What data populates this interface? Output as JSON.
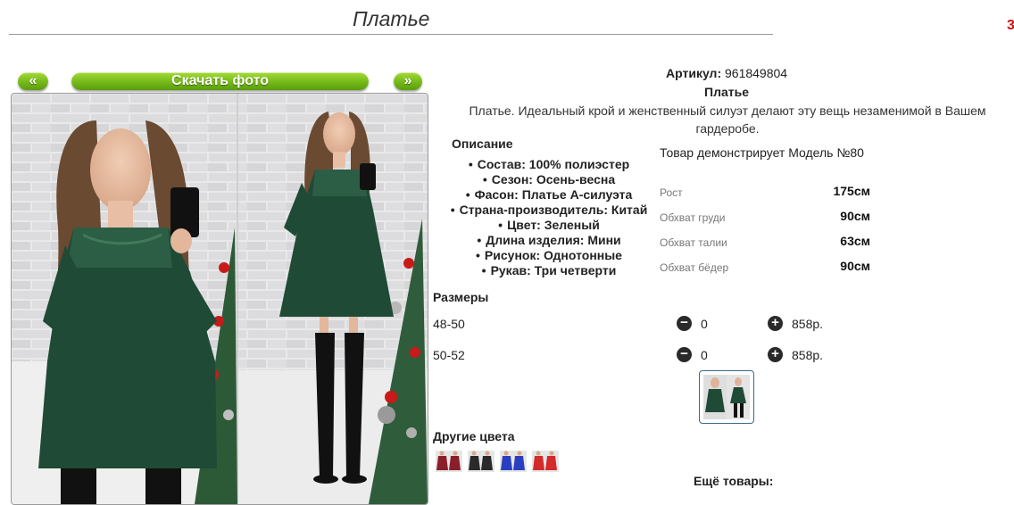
{
  "header": {
    "title": "Платье"
  },
  "gallery": {
    "prev_label": "«",
    "download_label": "Скачать фото",
    "next_label": "»"
  },
  "product": {
    "article_label": "Артикул:",
    "article_value": "961849804",
    "name": "Платье",
    "description": "Платье. Идеальный крой и женственный силуэт делают эту вещь незаменимой в Вашем гардеробе."
  },
  "specs": {
    "title": "Описание",
    "items": [
      "Состав: 100% полиэстер",
      "Сезон: Осень-весна",
      "Фасон: Платье А-силуэта",
      "Страна-производитель: Китай",
      "Цвет: Зеленый",
      "Длина изделия: Мини",
      "Рисунок: Однотонные",
      "Рукав: Три четверти"
    ]
  },
  "model": {
    "label": "Товар демонстрирует Модель №80",
    "measurements": [
      {
        "label": "Рост",
        "value": "175см"
      },
      {
        "label": "Обхват груди",
        "value": "90см"
      },
      {
        "label": "Обхват талии",
        "value": "63см"
      },
      {
        "label": "Обхват бёдер",
        "value": "90см"
      }
    ]
  },
  "sizes": {
    "title": "Размеры",
    "rows": [
      {
        "size": "48-50",
        "qty": "0",
        "price": "858р."
      },
      {
        "size": "50-52",
        "qty": "0",
        "price": "858р."
      }
    ]
  },
  "other_colors": {
    "title": "Другие цвета",
    "swatches": [
      {
        "name": "burgundy",
        "color": "#8a1e2a"
      },
      {
        "name": "black",
        "color": "#2a2a2a"
      },
      {
        "name": "blue",
        "color": "#2a3fc0"
      },
      {
        "name": "red",
        "color": "#d42a2a"
      }
    ]
  },
  "footer": {
    "more_title": "Ещё товары:"
  },
  "colors": {
    "button_green": "#7cbf1d",
    "dress_green": "#1f4a36",
    "title_line": "#9a9a9a"
  }
}
